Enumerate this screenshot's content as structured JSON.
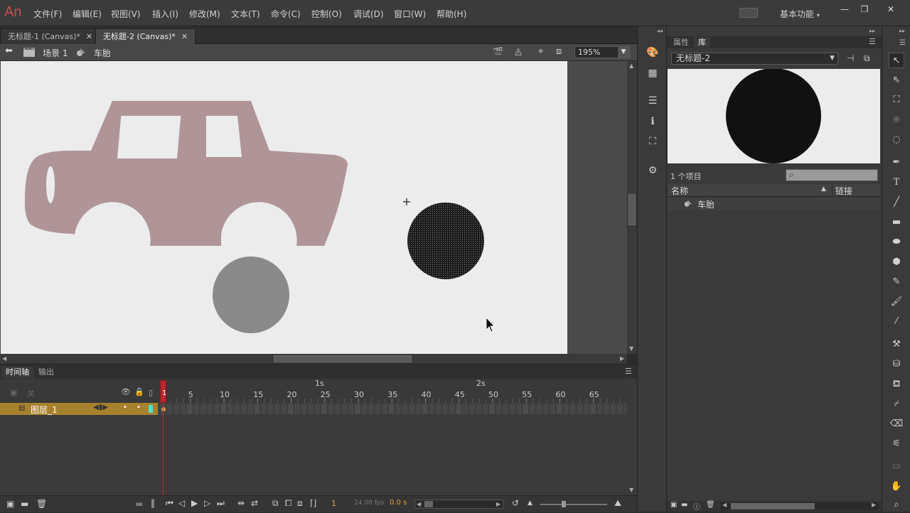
{
  "app": {
    "logo": "An"
  },
  "menu": [
    "文件(F)",
    "编辑(E)",
    "视图(V)",
    "插入(I)",
    "修改(M)",
    "文本(T)",
    "命令(C)",
    "控制(O)",
    "调试(D)",
    "窗口(W)",
    "帮助(H)"
  ],
  "workspace": {
    "label": "基本功能"
  },
  "window_buttons": [
    "—",
    "❐",
    "✕"
  ],
  "tabs": [
    {
      "label": "无标题-1 (Canvas)*",
      "active": false
    },
    {
      "label": "无标题-2 (Canvas)*",
      "active": true
    }
  ],
  "editbar": {
    "scene": "场景 1",
    "symbol": "车胎",
    "zoom": "195%"
  },
  "timeline": {
    "tabs": [
      "时间轴",
      "输出"
    ],
    "second_markers": [
      "1s",
      "2s"
    ],
    "frame_ticks": [
      "1",
      "5",
      "10",
      "15",
      "20",
      "25",
      "30",
      "35",
      "40",
      "45",
      "50",
      "55",
      "60",
      "65"
    ],
    "folder_label": "关",
    "layer_name": "图层_1",
    "current_frame": "1",
    "fps": "24.00 fps",
    "elapsed": "0.0 s"
  },
  "library": {
    "tabs": [
      "属性",
      "库"
    ],
    "document": "无标题-2",
    "item_count": "1 个项目",
    "search_placeholder": "",
    "columns": {
      "name": "名称",
      "linkage": "链接"
    },
    "items": [
      {
        "name": "车胎",
        "type": "graphic-symbol"
      }
    ]
  },
  "colors": {
    "car_body": "#b09598",
    "tire_gray": "#8a8a8a",
    "stage_bg": "#ececec",
    "layer_highlight": "#a8812d",
    "playhead": "#b8282e"
  }
}
